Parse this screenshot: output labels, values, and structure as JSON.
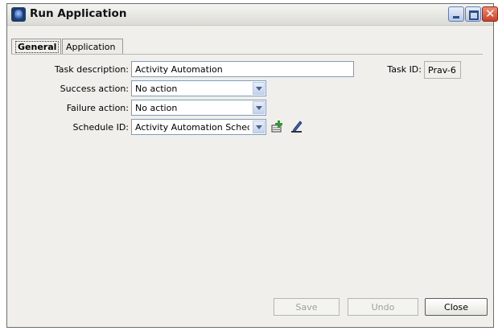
{
  "window": {
    "title": "Run Application"
  },
  "tabs": [
    {
      "label": "General",
      "selected": true
    },
    {
      "label": "Application",
      "selected": false
    }
  ],
  "form": {
    "task_description": {
      "label": "Task description:",
      "value": "Activity Automation"
    },
    "task_id": {
      "label": "Task ID:",
      "value": "Prav-6"
    },
    "success_action": {
      "label": "Success action:",
      "value": "No action"
    },
    "failure_action": {
      "label": "Failure action:",
      "value": "No action"
    },
    "schedule_id": {
      "label": "Schedule ID:",
      "value": "Activity Automation Schedule"
    }
  },
  "buttons": {
    "save": "Save",
    "undo": "Undo",
    "close": "Close"
  },
  "icons": {
    "window": "app-icon",
    "minimize": "minimize-icon",
    "maximize": "maximize-icon",
    "close": "close-icon",
    "new_schedule": "new-schedule-icon",
    "edit_schedule": "edit-schedule-icon"
  },
  "colors": {
    "close_button": "#c9412a",
    "window_bg": "#f0efeb",
    "field_border": "#7f9db9"
  }
}
